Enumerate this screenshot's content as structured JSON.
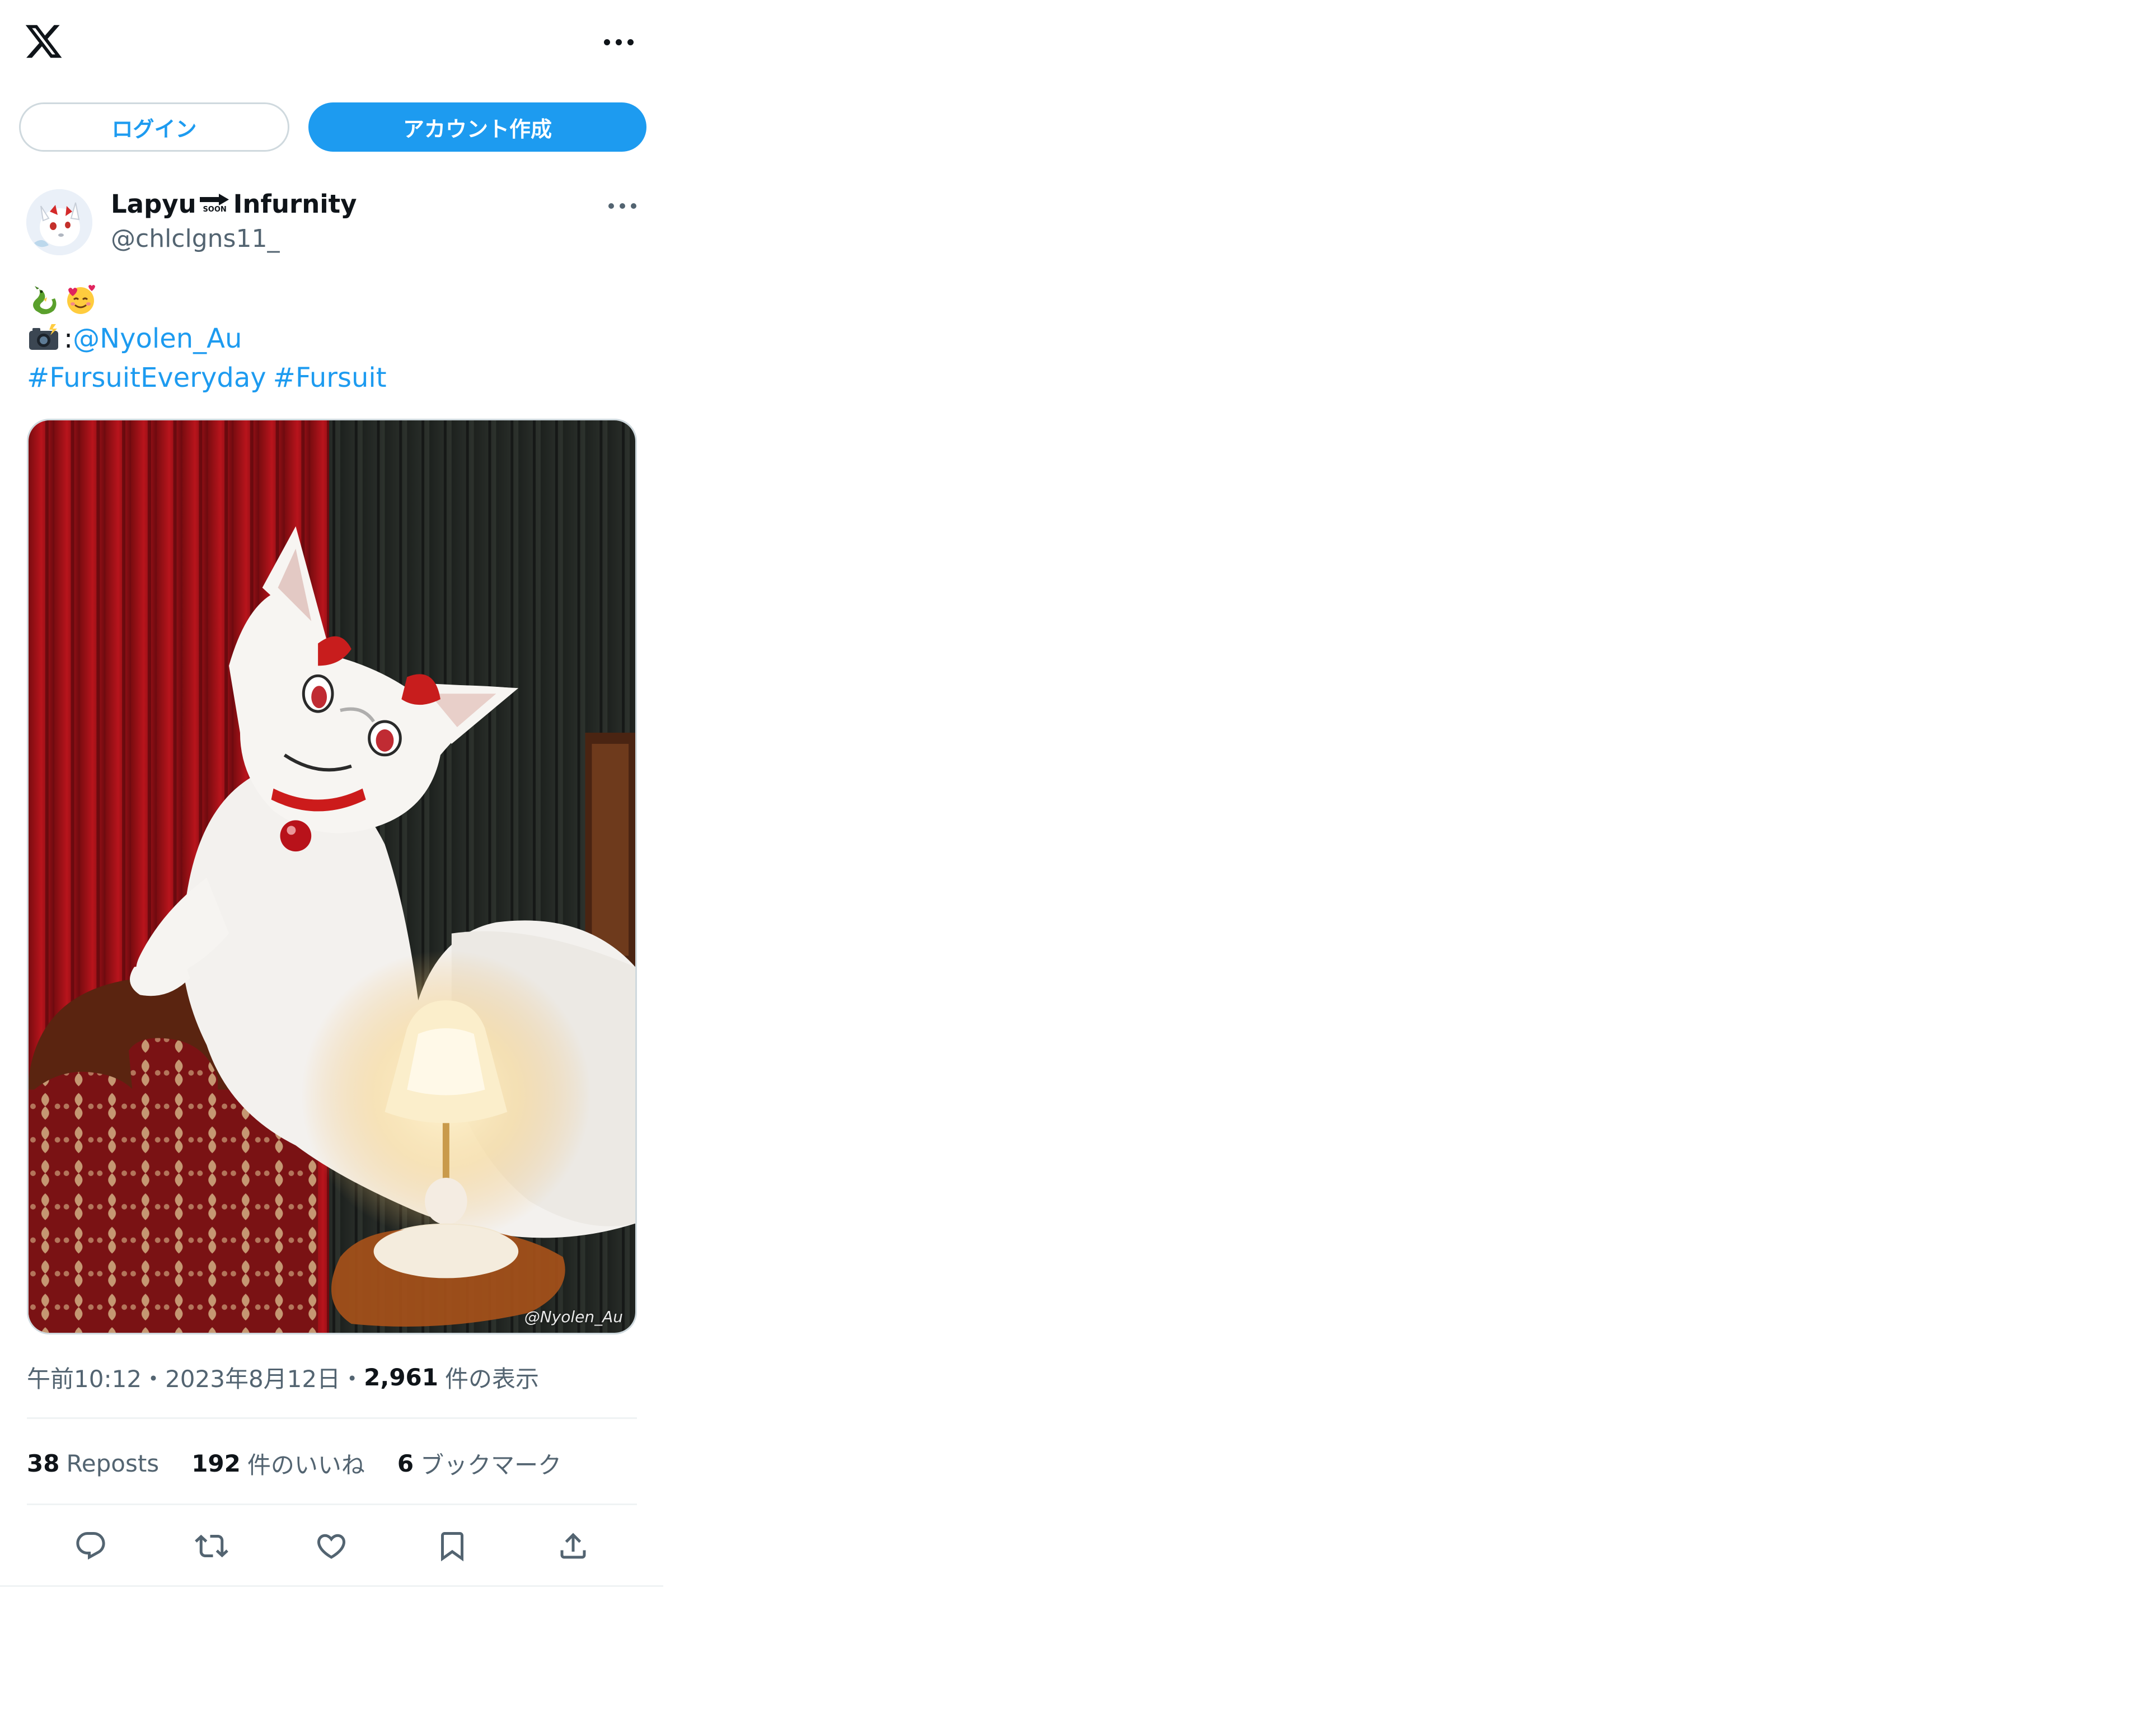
{
  "header": {
    "logo_icon": "x-logo-icon",
    "more_icon": "more-icon"
  },
  "auth": {
    "login_label": "ログイン",
    "signup_label": "アカウント作成"
  },
  "tweet": {
    "author": {
      "name_part1": "Lapyu",
      "name_badge": "SOON",
      "name_part2": "Infurnity",
      "handle": "@chlclgns11_"
    },
    "text": {
      "line1_emojis": [
        "dragon-emoji",
        "smiling-face-with-hearts-emoji"
      ],
      "line2_camera_emoji": "camera-with-flash-emoji",
      "line2_colon": ":",
      "line2_mention": "@Nyolen_Au",
      "hashtag1": "#FursuitEveryday",
      "hashtag2": "#Fursuit"
    },
    "photo": {
      "credit": "@Nyolen_Au"
    },
    "meta": {
      "time": "午前10:12",
      "sep1": "・",
      "date": "2023年8月12日",
      "sep2": "・",
      "views_count": "2,961",
      "views_label": "件の表示"
    },
    "stats": {
      "reposts_count": "38",
      "reposts_label": "Reposts",
      "likes_count": "192",
      "likes_label": "件のいいね",
      "bookmarks_count": "6",
      "bookmarks_label": "ブックマーク"
    }
  },
  "colors": {
    "accent": "#1d9bf0",
    "text_primary": "#0f1419",
    "text_secondary": "#536471",
    "border": "#cfd9de",
    "divider": "#eff3f4"
  }
}
